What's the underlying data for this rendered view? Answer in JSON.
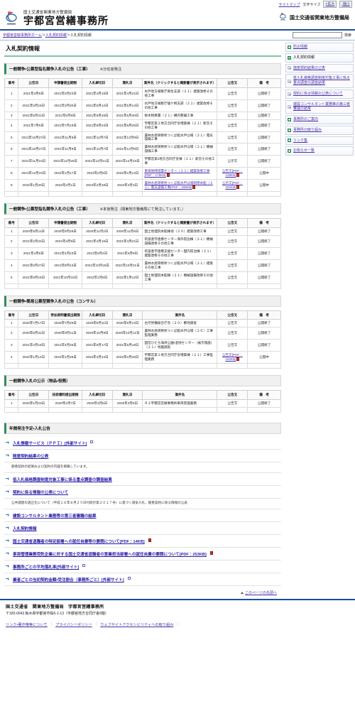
{
  "utility": {
    "sitemap": "サイトマップ",
    "fontsize_label": "文字サイズ",
    "enlarge": "+拡大",
    "reduce": "-縮小"
  },
  "header": {
    "ministry": "国土交通省関東地方整備局",
    "office": "宇都宮営繕事務所",
    "right_label": "国土交通省関東地方整備局"
  },
  "breadcrumb": {
    "home": "宇都宮営繕事務所ホーム",
    "sep": "＞",
    "level2": "入札契約情報",
    "current": "入札契約情報"
  },
  "search": {
    "value": "",
    "placeholder": "",
    "button": "検索"
  },
  "page_title": "入札契約情報",
  "sidebar": {
    "items": [
      {
        "label": "防災情報",
        "type": "top",
        "current": false
      },
      {
        "label": "入札契約情報",
        "type": "top",
        "current": true
      },
      {
        "label": "随意契約結果の公表",
        "type": "sub",
        "current": false
      },
      {
        "label": "低入札価格調査制度対象工事に係る重点調査の調査結果",
        "type": "sub",
        "current": false
      },
      {
        "label": "契約に係る情報の公表について",
        "type": "sub",
        "current": false
      },
      {
        "label": "建設コンサルタント業務等の第三者審議の結果",
        "type": "sub",
        "current": false
      },
      {
        "label": "事務所のご案内",
        "type": "top",
        "current": false
      },
      {
        "label": "事務所の取り組み",
        "type": "top",
        "current": false
      },
      {
        "label": "リンク集",
        "type": "top",
        "current": false
      },
      {
        "label": "お知らせ一覧",
        "type": "top",
        "current": false
      }
    ]
  },
  "sections": [
    {
      "heading": "一般競争・公募型指名競争入札の公告（工事）",
      "note": "※分任官発注",
      "columns": [
        "番号",
        "公告日",
        "申請書提出期限",
        "入札締切日",
        "開札日",
        "案件名（クリックすると概要書が表示されます）",
        "公告文",
        "備　考"
      ],
      "rows": [
        {
          "no": "1",
          "koukoku": "2021年3月8日",
          "teishutsu": "2021年3月23日",
          "shimekiri": "2021年4月19日",
          "kaisatsu": "2021年4月21日",
          "name": "水戸地方検察庁麻生支部（２１）建築改修その他工事",
          "name_link": false,
          "name_pdf": "",
          "koukokubun": "公告文",
          "koukokubun_link": false,
          "koukokubun_pdf": "",
          "biko": "公開終了"
        },
        {
          "no": "2",
          "koukoku": "2021年3月15日",
          "teishutsu": "2021年3月30日",
          "shimekiri": "2021年5月12日",
          "kaisatsu": "2021年5月14日",
          "name": "水戸地方検察庁龍ケ崎支部（２１）建築改修その他工事",
          "name_link": false,
          "name_pdf": "",
          "koukokubun": "公告文",
          "koukokubun_link": false,
          "koukokubun_pdf": "",
          "biko": "公開終了"
        },
        {
          "no": "3",
          "koukoku": "2021年5月31日",
          "teishutsu": "2021年6月8日",
          "shimekiri": "2021年6月28日",
          "kaisatsu": "2021年6月30日",
          "name": "栃木税務署（２１）構内整備工事",
          "name_link": false,
          "name_pdf": "",
          "koukokubun": "公告文",
          "koukokubun_link": false,
          "koukokubun_pdf": "",
          "biko": "公開終了"
        },
        {
          "no": "4",
          "koukoku": "2021年7月6日",
          "teishutsu": "2021年7月19日",
          "shimekiri": "2021年8月23日",
          "kaisatsu": "2021年8月25日",
          "name": "宇都宮第２地方合同庁舎増築棟（２１）新営その他工事",
          "name_link": false,
          "name_pdf": "",
          "koukokubun": "公告文",
          "koukokubun_link": false,
          "koukokubun_pdf": "",
          "biko": "公開終了"
        },
        {
          "no": "5",
          "koukoku": "2021年10月27日",
          "teishutsu": "2021年11月9日",
          "shimekiri": "2021年12月7日",
          "kaisatsu": "2021年12月9日",
          "name": "農林水産研修所つくば館水戸ほ場（２１）電気設備工事",
          "name_link": false,
          "name_pdf": "",
          "koukokubun": "公告文",
          "koukokubun_link": false,
          "koukokubun_pdf": "",
          "biko": "公開終了"
        },
        {
          "no": "6",
          "koukoku": "2021年10月27日",
          "teishutsu": "2021年11月9日",
          "shimekiri": "2021年12月7日",
          "kaisatsu": "2021年12月9日",
          "name": "農林水産研修所つくば館水戸ほ場（２１）機械設備工事",
          "name_link": false,
          "name_pdf": "",
          "koukokubun": "公告文",
          "koukokubun_link": false,
          "koukokubun_pdf": "",
          "biko": "公開終了"
        },
        {
          "no": "7",
          "koukoku": "2021年11月10日",
          "teishutsu": "2021年11月26日",
          "shimekiri": "2021年12月21日",
          "kaisatsu": "2021年12月23日",
          "name": "宇都宮第2地方合同庁舎棟（２１）新営その他工事",
          "name_link": false,
          "name_pdf": "",
          "koukokubun": "公示文",
          "koukokubun_link": false,
          "koukokubun_pdf": "",
          "biko": "公開終了"
        },
        {
          "no": "8",
          "koukoku": "2021年12月23日",
          "teishutsu": "2022年1月17日",
          "shimekiri": "2022年2月9日",
          "kaisatsu": "2022年2月14日",
          "name": "東海保障措置センター（２１）建築改修工事",
          "name_link": true,
          "name_pdf": "[PDF：175KB]",
          "koukokubun": "公告文",
          "koukokubun_link": true,
          "koukokubun_pdf": "[PDF：138KB]",
          "biko": "公開中"
        },
        {
          "no": "9",
          "koukoku": "2022年1月20日",
          "teishutsu": "2022年2月1日",
          "shimekiri": "2022年2月28日",
          "kaisatsu": "2022年3月2日",
          "name": "農林水産研修所つくば館水戸ほ場研修本館（２１）電気設備工事",
          "name_link": true,
          "name_pdf": "[PDF：188KB]",
          "koukokubun": "公示文",
          "koukokubun_link": true,
          "koukokubun_pdf": "[PDF：152KB]",
          "biko": "公開中"
        }
      ]
    },
    {
      "heading": "一般競争・公募型指名競争入札の公告（工事）",
      "note": "※本官発注（関東地方整備局にて発注しています。）",
      "columns": [
        "番号",
        "公告日",
        "申請書提出期限",
        "入札締切日",
        "開札日",
        "案件名（クリックすると概要書が表示されます）",
        "公告文",
        "備　考"
      ],
      "rows": [
        {
          "no": "1",
          "koukoku": "2020年9月11日",
          "teishutsu": "2020年9月29日",
          "shimekiri": "2020年11月2日",
          "kaisatsu": "2020年11月6日",
          "name": "国土地理院本館棟他（２０）建築改修工事",
          "name_link": false,
          "name_pdf": "",
          "koukokubun": "公告文",
          "koukokubun_link": false,
          "koukokubun_pdf": "",
          "biko": "公開終了"
        },
        {
          "no": "2",
          "koukoku": "2021年2月22日",
          "teishutsu": "2021年3月9日",
          "shimekiri": "2021年4月16日",
          "kaisatsu": "2021年4月21日",
          "name": "筑波産学連携センター海外宿泊棟（２１）機械設備改修その他工事",
          "name_link": false,
          "name_pdf": "",
          "koukokubun": "公告文",
          "koukokubun_link": false,
          "koukokubun_pdf": "",
          "biko": "公開終了"
        },
        {
          "no": "3",
          "koukoku": "2021年4月9日",
          "teishutsu": "2021年4月23日",
          "shimekiri": "2021年6月4日",
          "kaisatsu": "2021年6月9日",
          "name": "筑波産学連携支援センター国内宿泊棟（２１）建築改修その他工事",
          "name_link": false,
          "name_pdf": "",
          "koukokubun": "公告文",
          "koukokubun_link": false,
          "koukokubun_pdf": "",
          "biko": "公開終了"
        },
        {
          "no": "4",
          "koukoku": "2021年8月27日",
          "teishutsu": "2021年9月13日",
          "shimekiri": "2021年10月18日",
          "kaisatsu": "2021年10月21日",
          "name": "農林水産研修所つくば館水戸ほ場（２１）建築その他工事",
          "name_link": false,
          "name_pdf": "",
          "koukokubun": "公告文",
          "koukokubun_link": false,
          "koukokubun_pdf": "",
          "biko": "公開終了"
        },
        {
          "no": "5",
          "koukoku": "2021年9月16日",
          "teishutsu": "2021年10月15日",
          "shimekiri": "2022年1月6日",
          "kaisatsu": "2022年1月12日",
          "name": "国土地理院本館棟（２１）機械設備改修その他工事",
          "name_link": false,
          "name_pdf": "",
          "koukokubun": "公告文",
          "koukokubun_link": false,
          "koukokubun_pdf": "",
          "biko": "公開終了"
        }
      ]
    },
    {
      "heading": "一般競争・簡易公募型競争入札の公告（コンサル）",
      "note": "",
      "columns": [
        "番号",
        "公告日",
        "参加表明書提出期限",
        "入札締切日",
        "開札日",
        "案件名",
        "公告文",
        "備　考"
      ],
      "rows": [
        {
          "no": "1",
          "koukoku": "2020年7月17日",
          "teishutsu": "2020年7月29日",
          "shimekiri": "2020年9月11日",
          "kaisatsu": "2020年9月14日",
          "name": "古河労働総合庁舎（２０）敷地調査",
          "name_link": false,
          "name_pdf": "",
          "koukokubun": "公告文",
          "koukokubun_link": false,
          "koukokubun_pdf": "",
          "biko": "公開終了"
        },
        {
          "no": "2",
          "koukoku": "2020年8月31日",
          "teishutsu": "2020年9月11日",
          "shimekiri": "2020年10月9日",
          "kaisatsu": "2020年10月12日",
          "name": "農林水産研修所つくば館水戸ほ場（２０）工事監理業務",
          "name_link": false,
          "name_pdf": "",
          "koukokubun": "公告文",
          "koukokubun_link": false,
          "koukokubun_pdf": "",
          "biko": "公開終了"
        },
        {
          "no": "3",
          "koukoku": "2021年4月16日",
          "teishutsu": "2021年4月26日",
          "shimekiri": "2021年6月17日",
          "kaisatsu": "2021年6月18日",
          "name": "国営ひたち海浜公園・湿地センター（展示施設）（２１）地盤調査",
          "name_link": false,
          "name_pdf": "",
          "koukokubun": "公告文",
          "koukokubun_link": false,
          "koukokubun_pdf": "",
          "biko": "公開終了"
        },
        {
          "no": "4",
          "koukoku": "2022年1月14日",
          "teishutsu": "2022年1月28日",
          "shimekiri": "2022年2月24日",
          "kaisatsu": "2022年2月25日",
          "name": "宇都宮第２地方合同庁舎増築棟（２１）工事監理業務",
          "name_link": false,
          "name_pdf": "",
          "koukokubun": "公告文",
          "koukokubun_link": true,
          "koukokubun_pdf": "[PDF：192KB]",
          "biko": "公開中"
        }
      ]
    },
    {
      "heading": "一般競争入札の公示（物品・役務）",
      "note": "",
      "columns": [
        "番号",
        "公告日",
        "技術資料提出期限",
        "入札締切日",
        "開札日",
        "案件名",
        "公告文",
        "備　考"
      ],
      "rows": [
        {
          "no": "1",
          "koukoku": "2020年1月23日",
          "teishutsu": "2020年2月7日",
          "shimekiri": "2020年3月5日",
          "kaisatsu": "2020年3月6日",
          "name": "Ｒ２宇都宮営繕事務所車両管理業務",
          "name_link": false,
          "name_pdf": "",
          "koukokubun": "公告文",
          "koukokubun_link": false,
          "koukokubun_pdf": "",
          "biko": "公開終了"
        }
      ]
    }
  ],
  "bottom_section": {
    "heading": "年間発注予定・入札公告",
    "links": [
      {
        "label": "入札情報サービス（ＰＰＩ）[外部サイト]",
        "external": true,
        "pdf": false,
        "desc": ""
      },
      {
        "label": "随意契約結果の公表",
        "external": false,
        "pdf": false,
        "desc": "随意契約の結果および契約の内容を掲載しています。"
      },
      {
        "label": "低入札価格調査制度対象工事に係る重点調査の調査結果",
        "external": false,
        "pdf": false,
        "desc": ""
      },
      {
        "label": "契約に係る情報の公表について",
        "external": false,
        "pdf": false,
        "desc": "公共調達の適正化について（平成１８年８月２５日付財計第２０１７号）に基づく競争入札、随意契約に係る情報の公表"
      },
      {
        "label": "建設コンサルタント業務等の第三者審議の結果",
        "external": false,
        "pdf": false,
        "desc": ""
      },
      {
        "label": "入札契約情報",
        "external": false,
        "pdf": false,
        "desc": ""
      },
      {
        "label": "国土交通省退職者の特定部署への就任自粛等の要請について[PDF：14KB]",
        "external": false,
        "pdf": true,
        "desc": ""
      },
      {
        "label": "車両管理業務受託企業に対する国土交通省退職者の営業担当部署への就任自粛の要請について[PDF：253KB]",
        "external": false,
        "pdf": true,
        "desc": ""
      },
      {
        "label": "事務所ごとの平均落札率[外部サイト]",
        "external": true,
        "pdf": false,
        "desc": ""
      },
      {
        "label": "業者ごとの当初契約金額・受注割合（事務所ごと）[外部サイト]",
        "external": true,
        "pdf": false,
        "desc": ""
      }
    ]
  },
  "page_top": "このページの先頭へ",
  "footer": {
    "org": "国土交通省　関東地方整備局　宇都宮営繕事務所",
    "address": "〒320-0043 栃木県宇都宮市桜5-1-13（宇都宮地方合同庁舎9階）",
    "links": [
      "リンク・著作権等について",
      "プライバシーポリシー",
      "ウェブサイトアクセシビリティへの取り組み"
    ]
  }
}
